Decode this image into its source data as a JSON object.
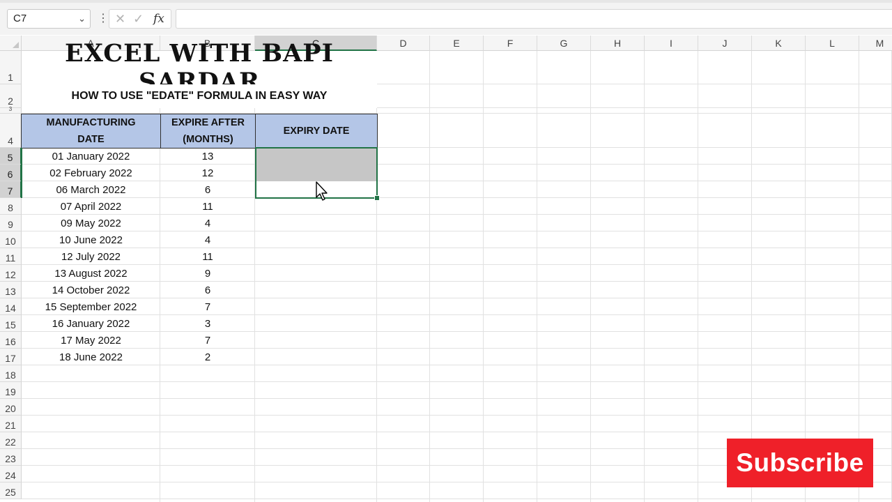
{
  "formula_bar": {
    "name_box": "C7",
    "dots": "⋮",
    "cancel_icon": "✕",
    "confirm_icon": "✓",
    "fx_label": "fx",
    "formula_value": ""
  },
  "columns": [
    "A",
    "B",
    "C",
    "D",
    "E",
    "F",
    "G",
    "H",
    "I",
    "J",
    "K",
    "L",
    "M"
  ],
  "rows": [
    "1",
    "2",
    "3",
    "4",
    "5",
    "6",
    "7",
    "8",
    "9",
    "10",
    "11",
    "12",
    "13",
    "14",
    "15",
    "16",
    "17",
    "18",
    "19",
    "20",
    "21",
    "22",
    "23",
    "24",
    "25"
  ],
  "sheet": {
    "title": "EXCEL WITH BAPI SARDAR",
    "subtitle": "HOW TO USE \"EDATE\" FORMULA IN EASY WAY",
    "headers": {
      "a": "MANUFACTURING DATE",
      "b": "EXPIRE AFTER (MONTHS)",
      "c": "EXPIRY DATE"
    },
    "data_rows": [
      {
        "date": "01 January 2022",
        "months": "13"
      },
      {
        "date": "02 February 2022",
        "months": "12"
      },
      {
        "date": "06 March 2022",
        "months": "6"
      },
      {
        "date": "07 April 2022",
        "months": "11"
      },
      {
        "date": "09 May 2022",
        "months": "4"
      },
      {
        "date": "10 June 2022",
        "months": "4"
      },
      {
        "date": "12 July 2022",
        "months": "11"
      },
      {
        "date": "13 August 2022",
        "months": "9"
      },
      {
        "date": "14 October 2022",
        "months": "6"
      },
      {
        "date": "15 September 2022",
        "months": "7"
      },
      {
        "date": "16 January 2022",
        "months": "3"
      },
      {
        "date": "17 May 2022",
        "months": "7"
      },
      {
        "date": "18 June 2022",
        "months": "2"
      }
    ]
  },
  "overlay": {
    "subscribe_label": "Subscribe"
  },
  "colors": {
    "header_fill": "#b4c6e7",
    "selection": "#217346",
    "subscribe_bg": "#ef2029"
  }
}
